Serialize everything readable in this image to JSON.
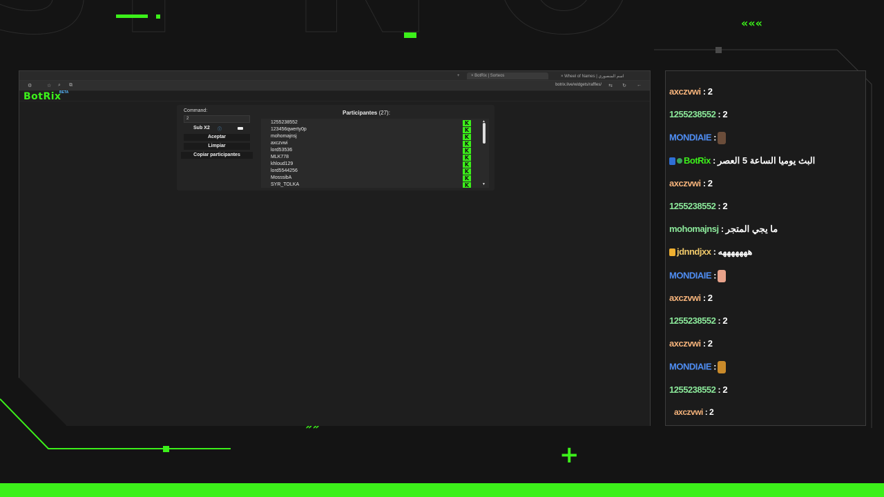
{
  "overlay": {
    "colors": {
      "accent": "#3cf01a",
      "background": "#141414"
    },
    "chevrons_top": "«««",
    "chevrons_bottom": "»»",
    "plus_sign": "+"
  },
  "browser": {
    "tabs": [
      {
        "label": "+"
      },
      {
        "label": "×  BotRix | Sorteos"
      },
      {
        "label": "×  Wheel of Names | اسم المنصوري"
      }
    ],
    "url": "botrix.live/widgets/raffles/"
  },
  "botrix": {
    "brand": "BotRix",
    "beta": "BETA",
    "command_label": "Command:",
    "command_value": "2",
    "sub_label": "Sub X2",
    "sub_info": "ⓘ",
    "accept_label": "Aceptar",
    "clear_label": "Limpiar",
    "copy_label": "Copiar participantes",
    "participants_title": "Participantes",
    "participants_count": "(27):",
    "participants": [
      "1255238552",
      "123456qwerty0p",
      "mohomajnsj",
      "axczvwi",
      "lord53536",
      "MLK778",
      "khloud129",
      "lord5544256",
      "MosssibA",
      "SYR_TOLKA"
    ],
    "kick_icon": "K"
  },
  "chat": {
    "messages": [
      {
        "user": "axczvwi",
        "text": ": 2",
        "color": "orange"
      },
      {
        "user": "1255238552",
        "text": ": 2",
        "color": "green"
      },
      {
        "user": "MONDIAIE",
        "text": ":",
        "color": "blue",
        "emote": "e1"
      },
      {
        "user": "BotRix",
        "text": ": البث يوميا الساعة 5 العصر",
        "color": "botrix",
        "badges": [
          "kick",
          "verified"
        ]
      },
      {
        "user": "axczvwi",
        "text": ": 2",
        "color": "orange"
      },
      {
        "user": "1255238552",
        "text": ": 2",
        "color": "green"
      },
      {
        "user": "mohomajnsj",
        "text": ": ما يجي المتجر",
        "color": "green"
      },
      {
        "user": "jdnndjxx",
        "text": ": هههههههه",
        "color": "gold",
        "badges": [
          "gold"
        ]
      },
      {
        "user": "MONDIAIE",
        "text": ":",
        "color": "blue",
        "emote": "e2"
      },
      {
        "user": "axczvwi",
        "text": ": 2",
        "color": "orange"
      },
      {
        "user": "1255238552",
        "text": ": 2",
        "color": "green"
      },
      {
        "user": "axczvwi",
        "text": ": 2",
        "color": "orange"
      },
      {
        "user": "MONDIAIE",
        "text": ":",
        "color": "blue",
        "emote": "e3"
      },
      {
        "user": "1255238552",
        "text": ": 2",
        "color": "green"
      },
      {
        "user": "axczvwi",
        "text": ": 2",
        "color": "orange"
      }
    ]
  }
}
